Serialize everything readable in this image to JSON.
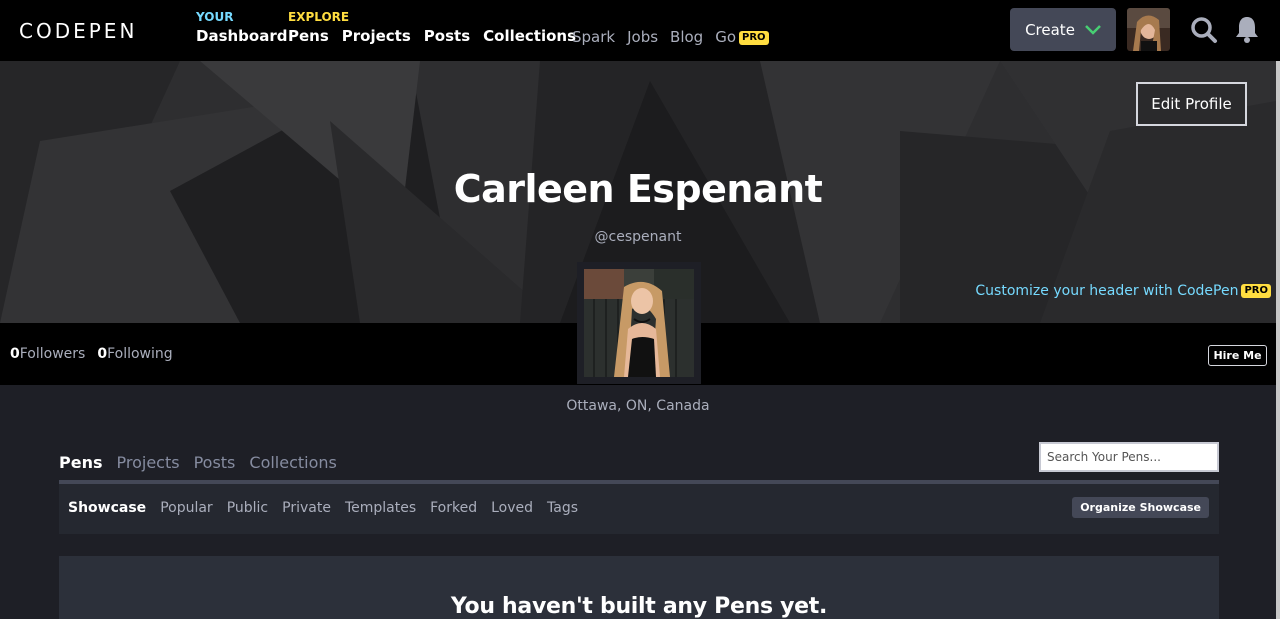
{
  "topbar": {
    "logo_text": "CODEPEN",
    "your_label": "YOUR",
    "dashboard": "Dashboard",
    "explore_label": "EXPLORE",
    "explore_items": [
      "Pens",
      "Projects",
      "Posts",
      "Collections"
    ],
    "secondary": [
      "Spark",
      "Jobs",
      "Blog",
      "Go"
    ],
    "go_badge": "PRO",
    "create_label": "Create",
    "colors": {
      "your": "#47cf73",
      "explore": "#ffdd40",
      "badge": "#ffdd40"
    }
  },
  "profile": {
    "edit_label": "Edit Profile",
    "name": "Carleen Espenant",
    "handle": "@cespenant",
    "customize_text": "Customize your header with CodePen",
    "customize_badge": "PRO",
    "followers_count": "0",
    "followers_label": "Followers",
    "following_count": "0",
    "following_label": "Following",
    "hire_label": "Hire Me",
    "location": "Ottawa, ON, Canada"
  },
  "tabs": {
    "items": [
      "Pens",
      "Projects",
      "Posts",
      "Collections"
    ],
    "active": "Pens",
    "search_placeholder": "Search Your Pens..."
  },
  "subtabs": {
    "items": [
      "Showcase",
      "Popular",
      "Public",
      "Private",
      "Templates",
      "Forked",
      "Loved",
      "Tags"
    ],
    "active": "Showcase",
    "organize_label": "Organize Showcase"
  },
  "empty": {
    "title": "You haven't built any Pens yet."
  },
  "icons": {
    "create_chevron": "chevron-down-icon",
    "search": "search-icon",
    "bell": "bell-icon"
  }
}
